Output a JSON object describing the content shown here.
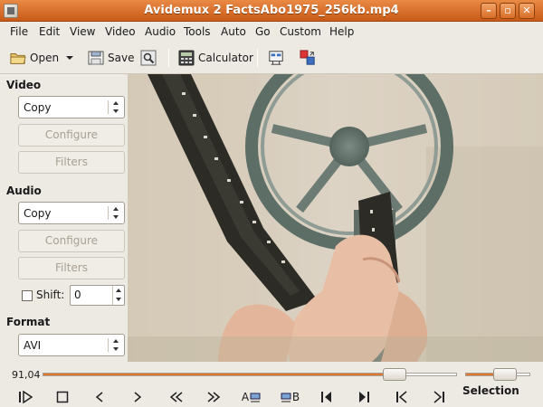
{
  "window": {
    "title": "Avidemux 2 FactsAbo1975_256kb.mp4",
    "minimize_icon": "minimize-icon",
    "maximize_icon": "maximize-icon",
    "close_icon": "close-icon"
  },
  "menu": [
    "File",
    "Edit",
    "View",
    "Video",
    "Audio",
    "Tools",
    "Auto",
    "Go",
    "Custom",
    "Help"
  ],
  "toolbar": {
    "open_label": "Open",
    "save_label": "Save",
    "calculator_label": "Calculator"
  },
  "video_section": {
    "title": "Video",
    "codec": "Copy",
    "configure_label": "Configure",
    "filters_label": "Filters"
  },
  "audio_section": {
    "title": "Audio",
    "codec": "Copy",
    "configure_label": "Configure",
    "filters_label": "Filters",
    "shift_label": "Shift:",
    "shift_value": "0",
    "shift_checked": false
  },
  "format_section": {
    "title": "Format",
    "value": "AVI"
  },
  "timeline": {
    "position_label": "91,04",
    "position_fraction": 0.85,
    "volume_fraction": 0.62
  },
  "navigation": {
    "buttons": [
      "play-icon",
      "stop-icon",
      "previous-frame-icon",
      "next-frame-icon",
      "rewind-icon",
      "fast-forward-icon",
      "set-marker-a-icon",
      "set-marker-b-icon",
      "previous-keyframe-icon",
      "next-keyframe-icon",
      "go-to-start-icon",
      "go-to-end-icon"
    ],
    "marker_a_label": "A",
    "marker_b_label": "B"
  },
  "selection": {
    "label": "Selection"
  },
  "colors": {
    "titlebar": "#d96d25",
    "accent": "#e0772d",
    "panel_bg": "#ede9e3"
  }
}
